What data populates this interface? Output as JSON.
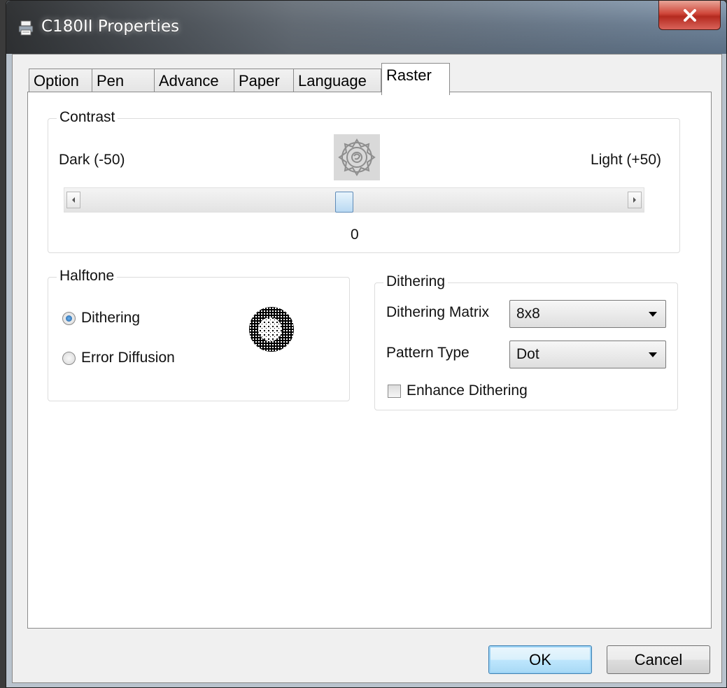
{
  "window": {
    "title": "C180II Properties"
  },
  "tabs": [
    {
      "label": "Option"
    },
    {
      "label": "Pen"
    },
    {
      "label": "Advance"
    },
    {
      "label": "Paper"
    },
    {
      "label": "Language"
    },
    {
      "label": "Raster",
      "active": true
    }
  ],
  "contrast": {
    "legend": "Contrast",
    "min_label": "Dark (-50)",
    "max_label": "Light (+50)",
    "value_label": "0",
    "value": 0,
    "min": -50,
    "max": 50
  },
  "halftone": {
    "legend": "Halftone",
    "options": [
      {
        "label": "Dithering",
        "selected": true
      },
      {
        "label": "Error Diffusion",
        "selected": false
      }
    ]
  },
  "dithering": {
    "legend": "Dithering",
    "matrix_label": "Dithering Matrix",
    "matrix_value": "8x8",
    "pattern_label": "Pattern Type",
    "pattern_value": "Dot",
    "enhance_label": "Enhance Dithering",
    "enhance_checked": false
  },
  "buttons": {
    "ok": "OK",
    "cancel": "Cancel"
  },
  "icons": {
    "app": "printer-icon",
    "close": "close-icon",
    "preview": "rose-preview-icon",
    "dither": "dither-sample-icon"
  },
  "colors": {
    "close_red": "#c8392c",
    "accent_blue": "#3c7fb1"
  }
}
